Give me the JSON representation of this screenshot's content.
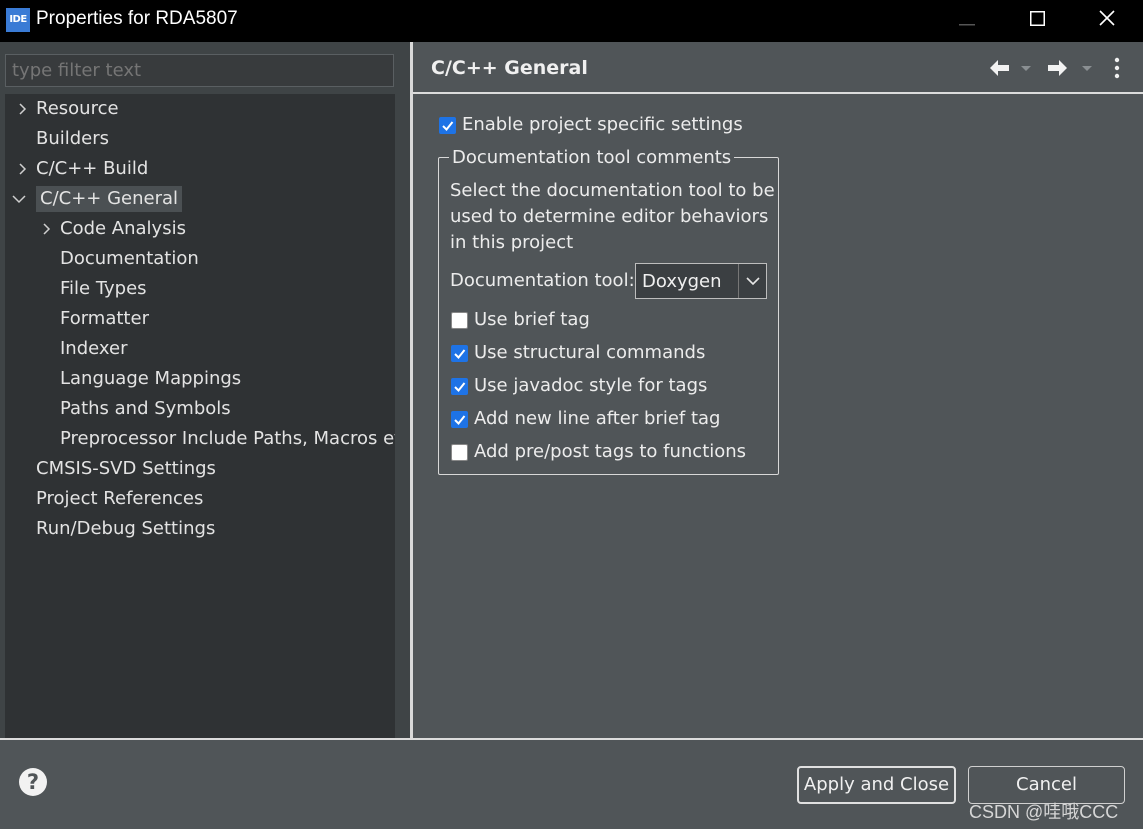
{
  "window": {
    "app_icon_text": "IDE",
    "title": "Properties for RDA5807",
    "controls": [
      "minimize-icon",
      "maximize-icon",
      "close-icon"
    ]
  },
  "sidebar": {
    "filter_placeholder": "type filter text",
    "items": [
      {
        "label": "Resource",
        "expander": "collapsed"
      },
      {
        "label": "Builders",
        "expander": "none"
      },
      {
        "label": "C/C++ Build",
        "expander": "collapsed"
      },
      {
        "label": "C/C++ General",
        "expander": "expanded",
        "selected": true
      },
      {
        "label": "Code Analysis",
        "expander": "collapsed"
      },
      {
        "label": "Documentation",
        "expander": "none"
      },
      {
        "label": "File Types",
        "expander": "none"
      },
      {
        "label": "Formatter",
        "expander": "none"
      },
      {
        "label": "Indexer",
        "expander": "none"
      },
      {
        "label": "Language Mappings",
        "expander": "none"
      },
      {
        "label": "Paths and Symbols",
        "expander": "none"
      },
      {
        "label": "Preprocessor Include Paths, Macros et",
        "expander": "none"
      },
      {
        "label": "CMSIS-SVD Settings",
        "expander": "none"
      },
      {
        "label": "Project References",
        "expander": "none"
      },
      {
        "label": "Run/Debug Settings",
        "expander": "none"
      }
    ]
  },
  "main": {
    "title": "C/C++ General",
    "header_icons": [
      "back-arrow-icon",
      "back-dropdown-icon",
      "forward-arrow-icon",
      "forward-dropdown-icon",
      "more-menu-icon"
    ],
    "enable_project_specific": {
      "label": "Enable project specific settings",
      "checked": true
    },
    "group": {
      "legend": "Documentation tool comments",
      "description": "Select the documentation tool to be used to determine editor behaviors in this project",
      "tool_label": "Documentation tool:",
      "tool_value": "Doxygen",
      "options": [
        {
          "label": "Use brief tag",
          "checked": false
        },
        {
          "label": "Use structural commands",
          "checked": true
        },
        {
          "label": "Use javadoc style for tags",
          "checked": true
        },
        {
          "label": "Add new line after brief tag",
          "checked": true
        },
        {
          "label": "Add pre/post tags to functions",
          "checked": false
        }
      ]
    }
  },
  "footer": {
    "help_icon": "help-icon",
    "help_glyph": "?",
    "apply_label": "Apply and Close",
    "cancel_label": "Cancel",
    "watermark": "CSDN @哇哦CCC"
  },
  "colors": {
    "checkbox_accent": "#1e73e6",
    "panel_bg": "#505558",
    "tree_bg": "#2f3234"
  }
}
